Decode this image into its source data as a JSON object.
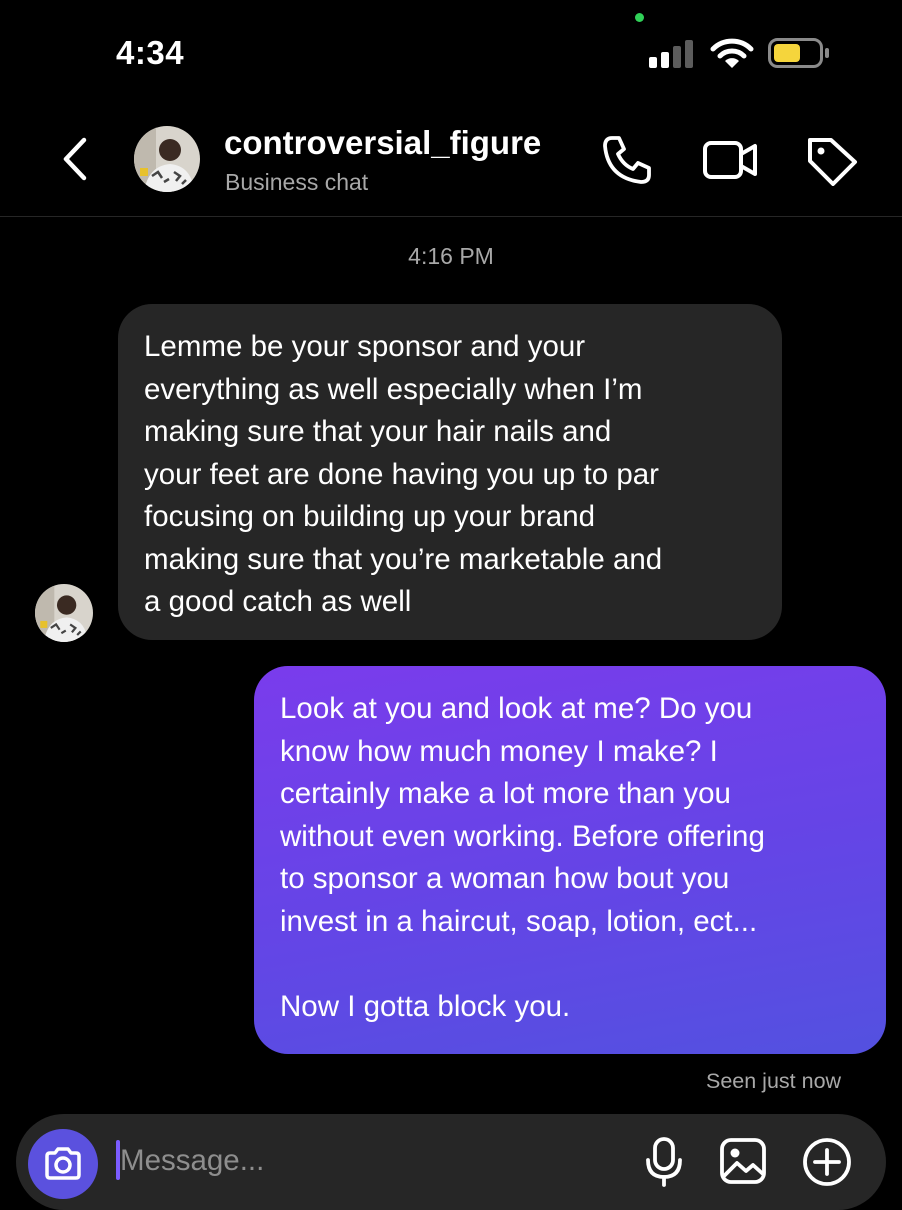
{
  "status_bar": {
    "time": "4:34",
    "signal_icon": "cellular-signal-icon",
    "wifi_icon": "wifi-icon",
    "battery_icon": "battery-low-icon",
    "battery_color": "#f5d53c",
    "privacy_dot_color": "#30d158"
  },
  "header": {
    "back_icon": "chevron-left-icon",
    "contact_name": "controversial_figure",
    "subtitle": "Business chat",
    "call_icon": "phone-icon",
    "video_icon": "video-camera-icon",
    "tag_icon": "tag-icon"
  },
  "chat": {
    "timestamp": "4:16 PM",
    "incoming": {
      "text": "Lemme be your sponsor and your\neverything as well especially when I’m\nmaking sure that your hair nails and\nyour feet are done having you up to par\nfocusing on building up your brand\nmaking sure that you’re marketable and\na good catch as well",
      "bubble_color": "#262626"
    },
    "outgoing": {
      "text": "Look at you and look at me? Do you\nknow how much money I make? I\ncertainly make a lot more than you\nwithout even working. Before offering\nto sponsor a woman how bout you\ninvest in a haircut, soap, lotion, ect...\n\nNow I gotta block you.",
      "bubble_gradient": [
        "#7a3cec",
        "#5351e0"
      ]
    },
    "seen_status": "Seen just now"
  },
  "composer": {
    "camera_icon": "camera-icon",
    "placeholder": "Message...",
    "value": "",
    "mic_icon": "microphone-icon",
    "gallery_icon": "gallery-icon",
    "plus_icon": "plus-circle-icon",
    "accent_color": "#5b51de"
  },
  "colors": {
    "background": "#000000",
    "secondary_text": "#a8a8a8"
  }
}
